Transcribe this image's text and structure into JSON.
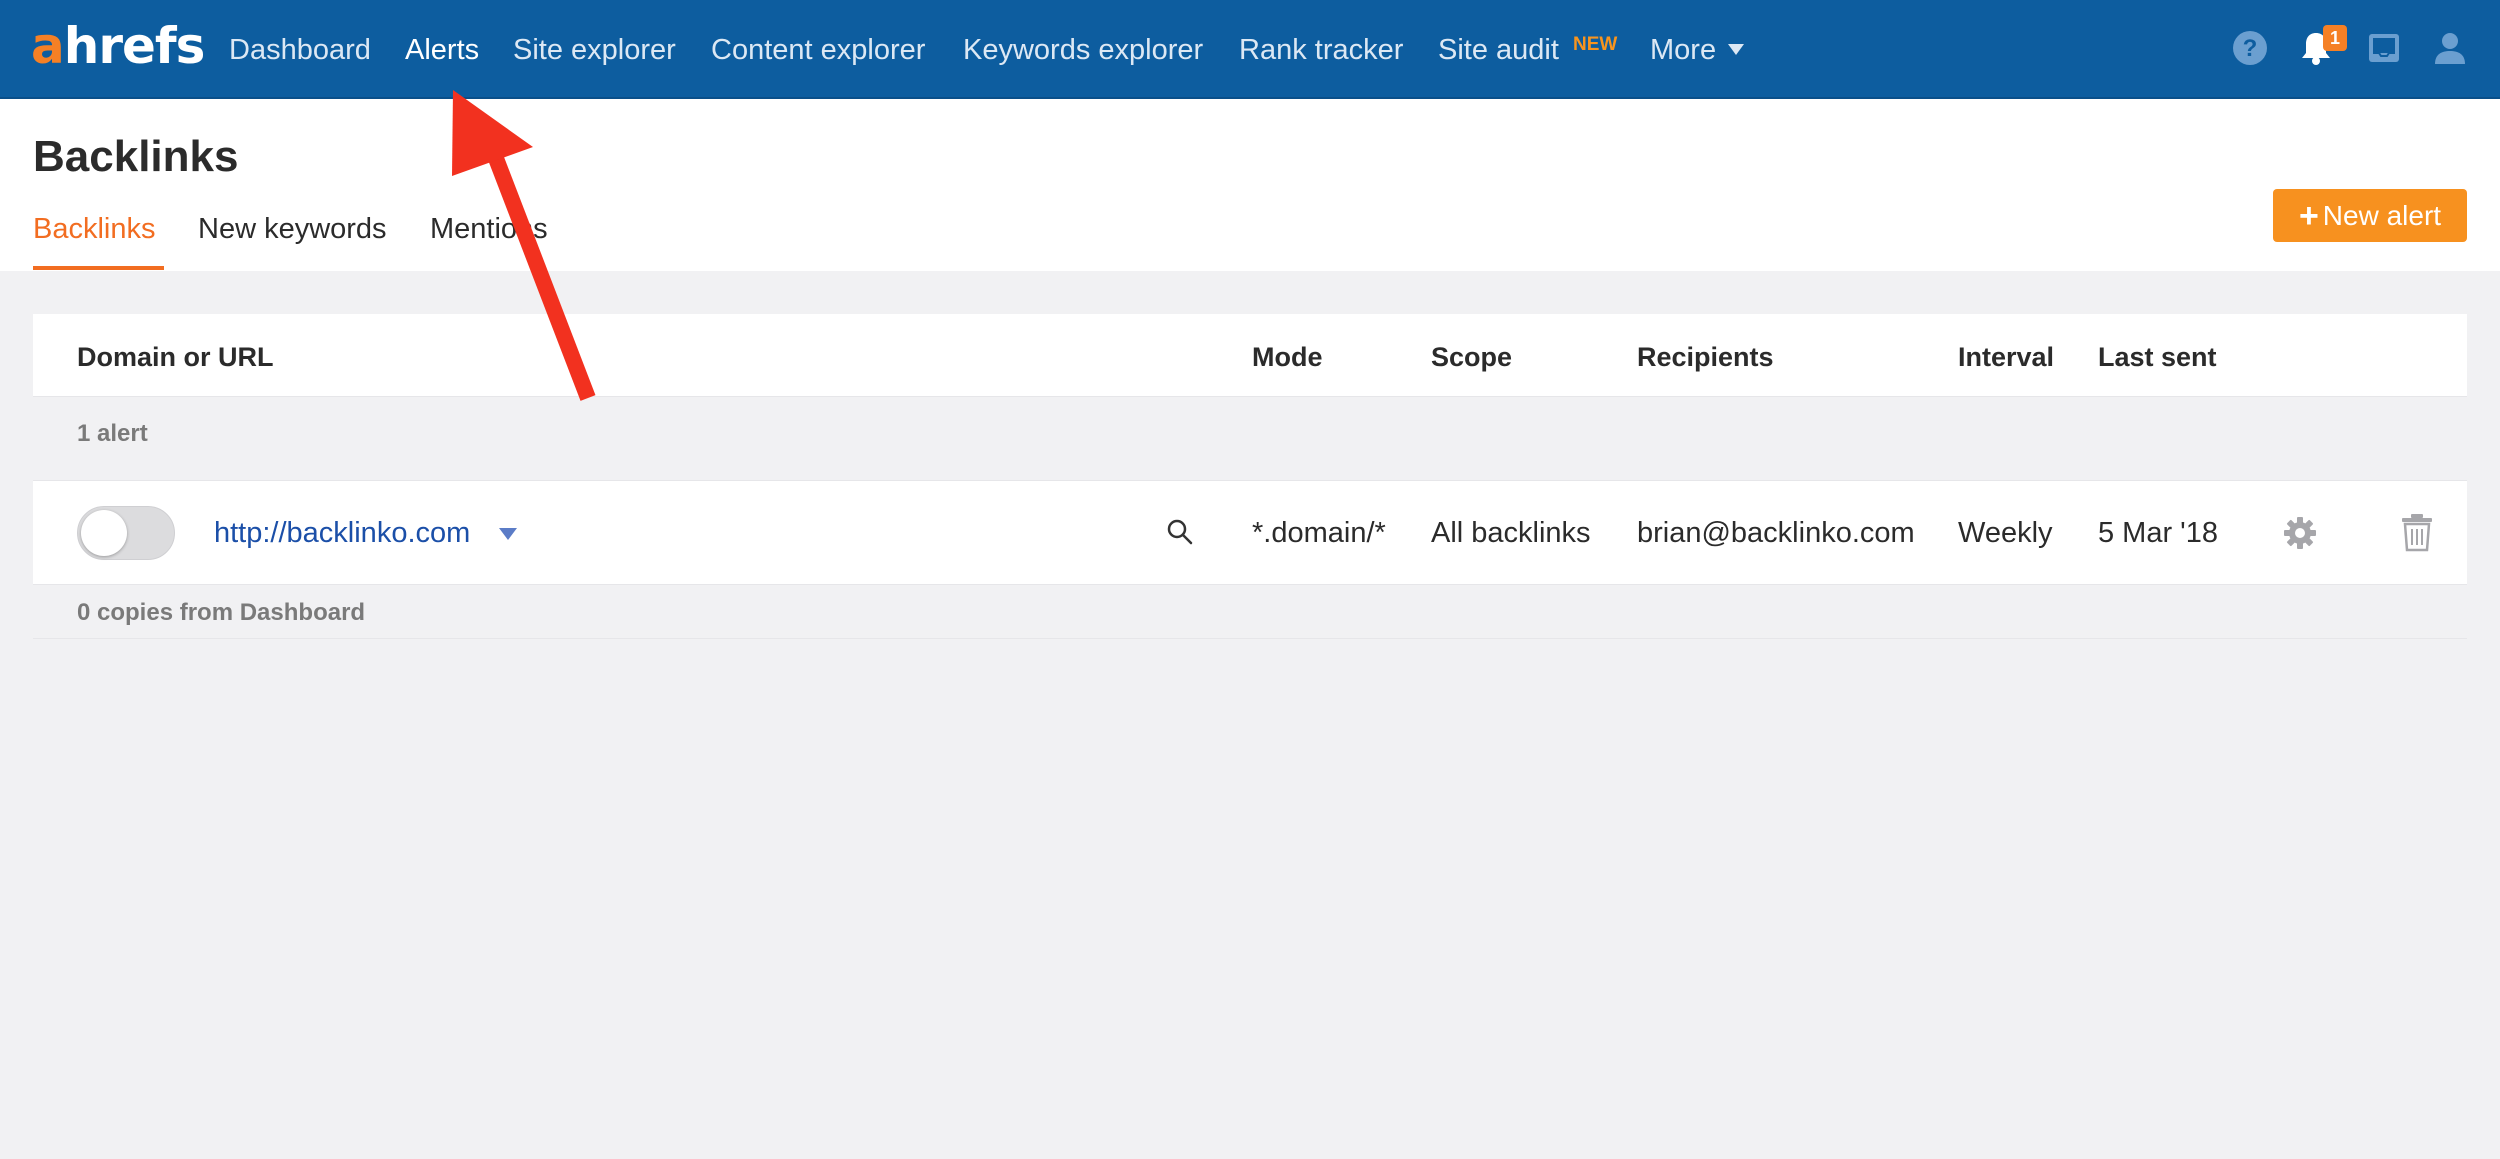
{
  "app": {
    "logo_prefix": "a",
    "logo_rest": "hrefs",
    "brand_color": "#0d5d9f",
    "accent_color": "#f58025"
  },
  "nav": {
    "items": [
      {
        "label": "Dashboard"
      },
      {
        "label": "Alerts"
      },
      {
        "label": "Site explorer"
      },
      {
        "label": "Content explorer"
      },
      {
        "label": "Keywords explorer"
      },
      {
        "label": "Rank tracker"
      },
      {
        "label": "Site audit"
      },
      {
        "label": "More"
      }
    ],
    "active": "Alerts",
    "site_audit_badge": "NEW",
    "notifications_count": "1",
    "icons": [
      "help-icon",
      "bell-icon",
      "inbox-icon",
      "user-icon"
    ]
  },
  "page": {
    "title": "Backlinks",
    "tabs": [
      {
        "label": "Backlinks"
      },
      {
        "label": "New keywords"
      },
      {
        "label": "Mentions"
      }
    ],
    "active_tab": "Backlinks",
    "new_alert_plus": "+",
    "new_alert_label": "New alert"
  },
  "table": {
    "columns": {
      "domain": "Domain or URL",
      "mode": "Mode",
      "scope": "Scope",
      "recipients": "Recipients",
      "interval": "Interval",
      "last_sent": "Last sent"
    },
    "group_label": "1 alert",
    "rows": [
      {
        "enabled": false,
        "url": "http://backlinko.com",
        "mode": "*.domain/*",
        "scope": "All backlinks",
        "recipients": "brian@backlinko.com",
        "interval": "Weekly",
        "last_sent": "5 Mar '18"
      }
    ],
    "footer_label": "0 copies from Dashboard"
  },
  "annotation": {
    "color": "#f2311f",
    "target": "Alerts"
  }
}
